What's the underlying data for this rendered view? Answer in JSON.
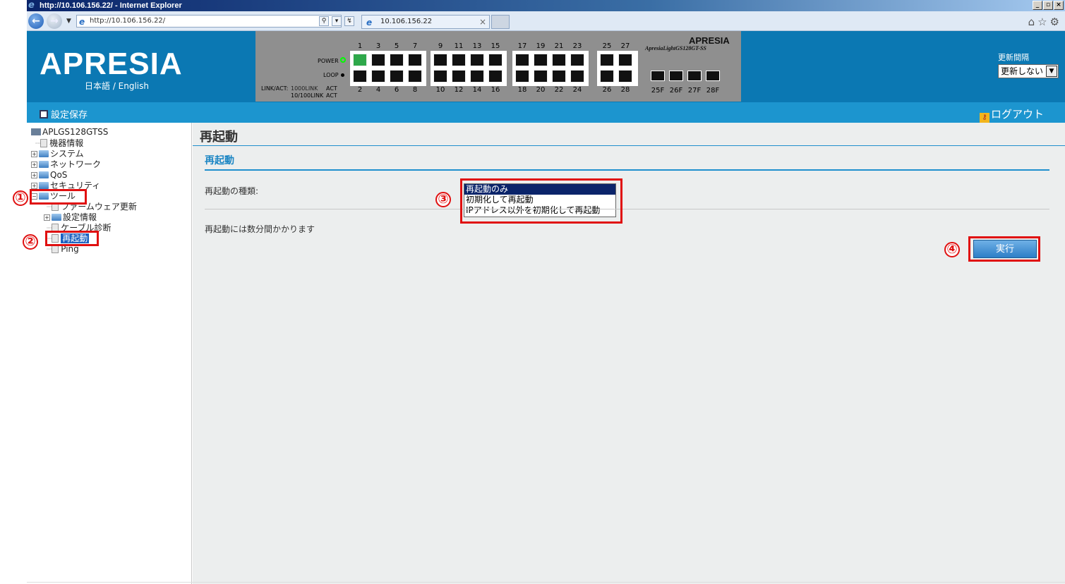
{
  "browser": {
    "title": "http://10.106.156.22/ - Internet Explorer",
    "address": "http://10.106.156.22/",
    "tab_label": "10.106.156.22"
  },
  "header": {
    "logo": "APRESIA",
    "language": "日本語 / English",
    "panel_brand": "APRESIA",
    "panel_model": "ApresiaLightGS128GT-SS",
    "power_label": "POWER",
    "loop_label": "LOOP",
    "linkact_label": "LINK/ACT:",
    "link1000": "1000LINK",
    "link100": "10/100LINK",
    "act1": "ACT",
    "act2": "ACT",
    "top_ports": [
      "1",
      "3",
      "5",
      "7",
      "9",
      "11",
      "13",
      "15",
      "17",
      "19",
      "21",
      "23",
      "25",
      "27"
    ],
    "bottom_ports": [
      "2",
      "4",
      "6",
      "8",
      "10",
      "12",
      "14",
      "16",
      "18",
      "20",
      "22",
      "24",
      "26",
      "28"
    ],
    "sfp_ports": [
      "25F",
      "26F",
      "27F",
      "28F"
    ],
    "refresh_label": "更新間隔",
    "refresh_value": "更新しない"
  },
  "subbar": {
    "save_label": "設定保存",
    "logout_label": "ログアウト"
  },
  "tree": {
    "root": "APLGS128GTSS",
    "items": {
      "device_info": "機器情報",
      "system": "システム",
      "network": "ネットワーク",
      "qos": "QoS",
      "security": "セキュリティ",
      "tools": "ツール",
      "firmware": "ファームウェア更新",
      "config_info": "設定情報",
      "cable_diag": "ケーブル診断",
      "reboot": "再起動",
      "ping": "Ping"
    }
  },
  "main": {
    "title": "再起動",
    "section": "再起動",
    "type_label": "再起動の種類:",
    "options": [
      "再起動のみ",
      "初期化して再起動",
      "IPアドレス以外を初期化して再起動"
    ],
    "note": "再起動には数分間かかります",
    "execute_label": "実行"
  },
  "annotations": {
    "n1": "①",
    "n2": "②",
    "n3": "③",
    "n4": "④",
    "color": "#e01010"
  }
}
